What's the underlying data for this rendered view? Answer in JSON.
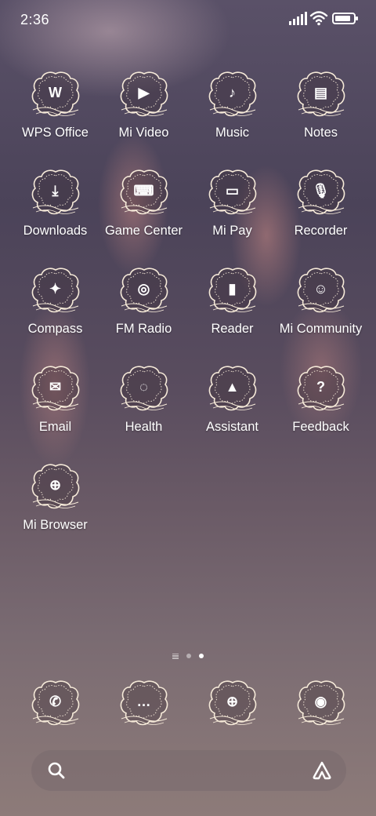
{
  "status_bar": {
    "time": "2:36",
    "battery_level": 0.85
  },
  "apps": [
    {
      "label": "WPS Office",
      "icon": "wps-icon",
      "glyph": "W"
    },
    {
      "label": "Mi Video",
      "icon": "play-icon",
      "glyph": "▶"
    },
    {
      "label": "Music",
      "icon": "music-note-icon",
      "glyph": "♪"
    },
    {
      "label": "Notes",
      "icon": "notepad-icon",
      "glyph": "▤"
    },
    {
      "label": "Downloads",
      "icon": "download-arrow-icon",
      "glyph": "⤓"
    },
    {
      "label": "Game Center",
      "icon": "gamepad-icon",
      "glyph": "⌨"
    },
    {
      "label": "Mi Pay",
      "icon": "card-icon",
      "glyph": "▭"
    },
    {
      "label": "Recorder",
      "icon": "microphone-icon",
      "glyph": "🎙"
    },
    {
      "label": "Compass",
      "icon": "compass-icon",
      "glyph": "✦"
    },
    {
      "label": "FM Radio",
      "icon": "radio-icon",
      "glyph": "◎"
    },
    {
      "label": "Reader",
      "icon": "book-icon",
      "glyph": "▮"
    },
    {
      "label": "Mi Community",
      "icon": "community-icon",
      "glyph": "☺"
    },
    {
      "label": "Email",
      "icon": "envelope-icon",
      "glyph": "✉"
    },
    {
      "label": "Health",
      "icon": "health-ring-icon",
      "glyph": "◌"
    },
    {
      "label": "Assistant",
      "icon": "assistant-icon",
      "glyph": "▲"
    },
    {
      "label": "Feedback",
      "icon": "feedback-icon",
      "glyph": "?"
    },
    {
      "label": "Mi Browser",
      "icon": "globe-icon",
      "glyph": "⊕"
    }
  ],
  "dock": [
    {
      "name": "phone",
      "icon": "phone-icon",
      "glyph": "✆"
    },
    {
      "name": "messages",
      "icon": "message-bubble-icon",
      "glyph": "…"
    },
    {
      "name": "browser",
      "icon": "globe-icon",
      "glyph": "⊕"
    },
    {
      "name": "camera",
      "icon": "camera-icon",
      "glyph": "◉"
    }
  ],
  "page_indicator": {
    "pages": 2,
    "active": 2
  },
  "colors": {
    "text": "#ffffff",
    "icon_line": "#f6ead9"
  }
}
